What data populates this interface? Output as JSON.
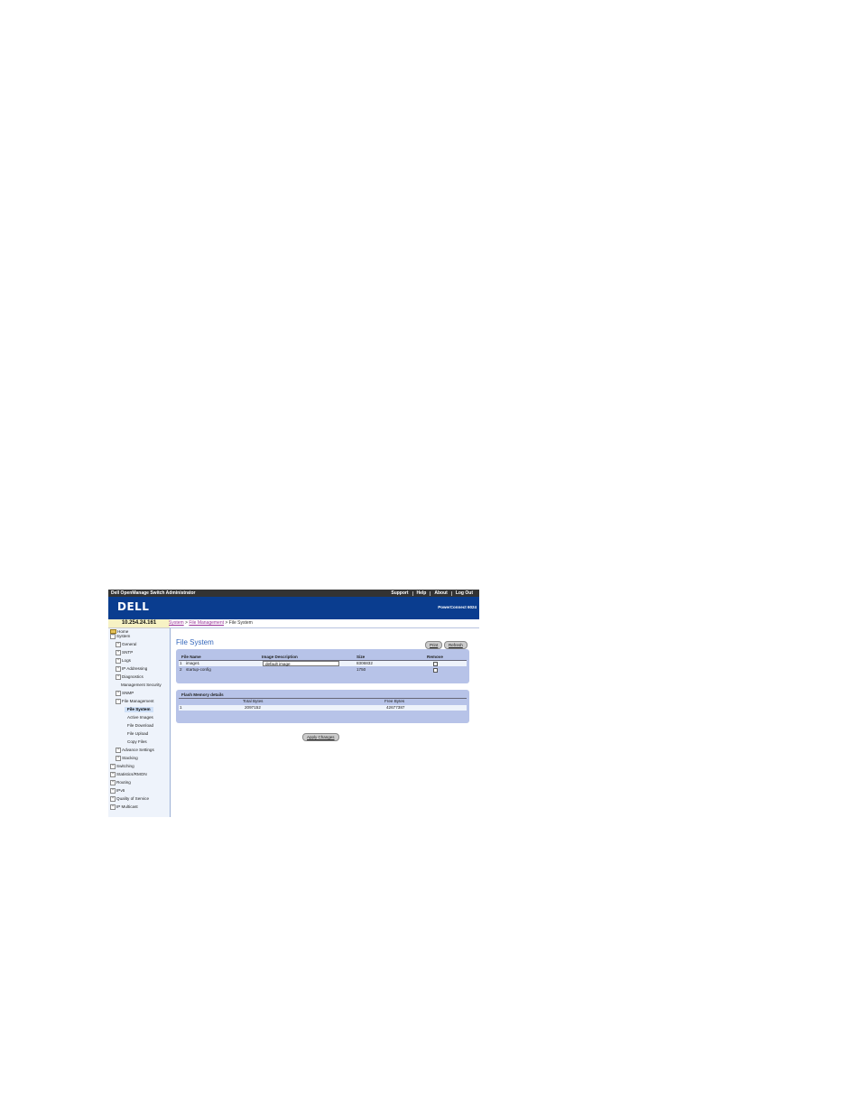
{
  "header": {
    "app_title": "Dell OpenManage Switch Administrator",
    "links": [
      "Support",
      "Help",
      "About",
      "Log Out"
    ],
    "logo": "DELL",
    "product": "PowerConnect 6024"
  },
  "ip_address": "10.254.24.161",
  "breadcrumb": {
    "part1": "System",
    "sep": " > ",
    "part2": "File Management",
    "current": " > File System"
  },
  "sidebar": {
    "home": "Home",
    "system": "System",
    "general": "General",
    "sntp": "SNTP",
    "logs": "Logs",
    "ip_addressing": "IP Addressing",
    "diagnostics": "Diagnostics",
    "management_security": "Management Security",
    "snmp": "SNMP",
    "file_management": "File Management",
    "file_system": "File System",
    "active_images": "Active Images",
    "file_download": "File Download",
    "file_upload": "File Upload",
    "copy_files": "Copy Files",
    "advance_settings": "Advance Settings",
    "stacking": "Stacking",
    "switching": "Switching",
    "statistics_rmon": "Statistics/RMON",
    "routing": "Routing",
    "ipv6": "IPv6",
    "quality_of_service": "Quality of Service",
    "ip_multicast": "IP Multicast",
    "expand_plus": "+",
    "expand_minus": "−"
  },
  "main": {
    "title": "File System",
    "print_label": "Print",
    "refresh_label": "Refresh",
    "files_table": {
      "headers": [
        "File Name",
        "Image Description",
        "Size",
        "Remove"
      ],
      "rows": [
        {
          "index": "1",
          "name": "image1",
          "description": "default image",
          "size": "8306832"
        },
        {
          "index": "2",
          "name": "startup-config",
          "description": "",
          "size": "1750"
        }
      ]
    },
    "flash": {
      "title": "Flash Memory details",
      "headers": [
        "Total Bytes",
        "Free Bytes"
      ],
      "row": {
        "index": "1",
        "total": "2097152",
        "free": "42677387"
      }
    },
    "apply_label": "Apply Changes"
  }
}
